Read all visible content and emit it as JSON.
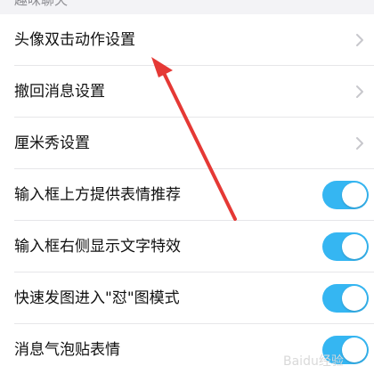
{
  "section": {
    "header": "趣味聊天"
  },
  "settings": [
    {
      "label": "头像双击动作设置",
      "control": "chevron"
    },
    {
      "label": "撤回消息设置",
      "control": "chevron"
    },
    {
      "label": "厘米秀设置",
      "control": "chevron"
    },
    {
      "label": "输入框上方提供表情推荐",
      "control": "toggle",
      "on": true
    },
    {
      "label": "输入框右侧显示文字特效",
      "control": "toggle",
      "on": true
    },
    {
      "label": "快速发图进入\"怼\"图模式",
      "control": "toggle",
      "on": true
    },
    {
      "label": "消息气泡贴表情",
      "control": "toggle",
      "on": true
    }
  ],
  "colors": {
    "toggle_on": "#35b6f2",
    "annotation_arrow": "#e53935",
    "chevron": "#c7c7cc"
  },
  "annotation": {
    "type": "arrow",
    "points_to": "头像双击动作设置"
  },
  "watermark": {
    "text": "Baidu经验"
  }
}
